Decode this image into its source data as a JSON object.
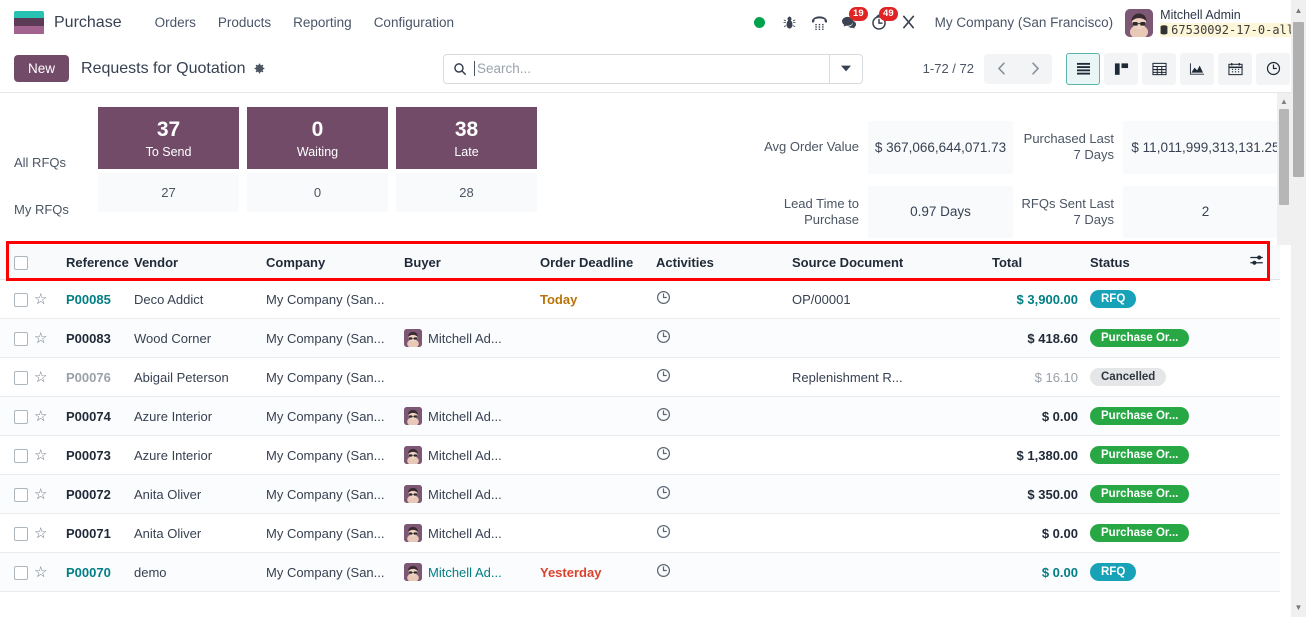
{
  "navbar": {
    "brand": "Purchase",
    "menu": [
      "Orders",
      "Products",
      "Reporting",
      "Configuration"
    ],
    "icons": [
      {
        "name": "status-dot-icon",
        "label": ""
      },
      {
        "name": "bug-icon",
        "label": ""
      },
      {
        "name": "voip-phone-icon",
        "label": ""
      },
      {
        "name": "messages-icon",
        "label": "",
        "count": "19"
      },
      {
        "name": "activities-clock-icon",
        "label": "",
        "count": "49"
      },
      {
        "name": "settings-tools-icon",
        "label": ""
      }
    ],
    "company": "My Company (San Francisco)",
    "user_name": "Mitchell Admin",
    "user_db": "67530092-17-0-all"
  },
  "control_panel": {
    "new_label": "New",
    "title": "Requests for Quotation",
    "gear_icon": "gear-icon",
    "search_placeholder": "Search...",
    "search_value": "",
    "pager": "1-72 / 72",
    "views": [
      {
        "name": "list-view",
        "icon": "list-icon",
        "active": true
      },
      {
        "name": "kanban-view",
        "icon": "kanban-icon",
        "active": false
      },
      {
        "name": "pivot-view",
        "icon": "pivot-icon",
        "active": false
      },
      {
        "name": "graph-view",
        "icon": "graph-icon",
        "active": false
      },
      {
        "name": "calendar-view",
        "icon": "calendar-icon",
        "active": false
      },
      {
        "name": "activity-view",
        "icon": "clock-icon",
        "active": false
      }
    ]
  },
  "dashboard": {
    "row_labels": [
      "All RFQs",
      "My RFQs"
    ],
    "columns": [
      {
        "label": "To Send",
        "all": "37",
        "my": "27"
      },
      {
        "label": "Waiting",
        "all": "0",
        "my": "0"
      },
      {
        "label": "Late",
        "all": "38",
        "my": "28"
      }
    ],
    "metrics": [
      {
        "label": "Avg Order Value",
        "value": "$ 367,066,644,071.73"
      },
      {
        "label": "Purchased Last 7 Days",
        "value": "$ 11,011,999,313,131.25"
      },
      {
        "label": "Lead Time to Purchase",
        "value": "0.97 Days"
      },
      {
        "label": "RFQs Sent Last 7 Days",
        "value": "2"
      }
    ]
  },
  "table": {
    "headers": [
      "Reference",
      "Vendor",
      "Company",
      "Buyer",
      "Order Deadline",
      "Activities",
      "Source Document",
      "Total",
      "Status"
    ],
    "config_icon": "column-options-icon",
    "rows": [
      {
        "reference": "P00085",
        "ref_link": true,
        "vendor": "Deco Addict",
        "vendor_link": true,
        "company": "My Company (San...",
        "company_link": true,
        "buyer": "",
        "has_avatar": false,
        "deadline": "Today",
        "deadline_style": "today",
        "activity_icon": "clock-icon",
        "source": "OP/00001",
        "source_link": true,
        "total": "$ 3,900.00",
        "total_style": "link",
        "status": "RFQ",
        "status_style": "rfq",
        "highlighted": true
      },
      {
        "reference": "P00083",
        "ref_link": false,
        "vendor": "Wood Corner",
        "vendor_link": false,
        "company": "My Company (San...",
        "company_link": false,
        "buyer": "Mitchell Ad...",
        "has_avatar": true,
        "deadline": "",
        "deadline_style": "",
        "activity_icon": "clock-icon",
        "source": "",
        "source_link": false,
        "total": "$ 418.60",
        "total_style": "bold",
        "status": "Purchase Or...",
        "status_style": "po",
        "highlighted": false
      },
      {
        "reference": "P00076",
        "ref_link": false,
        "vendor": "Abigail Peterson",
        "vendor_link": false,
        "company": "My Company (San...",
        "company_link": false,
        "buyer": "",
        "has_avatar": false,
        "deadline": "",
        "deadline_style": "",
        "activity_icon": "clock-icon",
        "source": "Replenishment R...",
        "source_link": false,
        "total": "$ 16.10",
        "total_style": "muted",
        "status": "Cancelled",
        "status_style": "cancel",
        "muted": true,
        "highlighted": false
      },
      {
        "reference": "P00074",
        "ref_link": false,
        "vendor": "Azure Interior",
        "vendor_link": false,
        "company": "My Company (San...",
        "company_link": false,
        "buyer": "Mitchell Ad...",
        "has_avatar": true,
        "deadline": "",
        "deadline_style": "",
        "activity_icon": "clock-icon",
        "source": "",
        "source_link": false,
        "total": "$ 0.00",
        "total_style": "bold",
        "status": "Purchase Or...",
        "status_style": "po",
        "highlighted": false
      },
      {
        "reference": "P00073",
        "ref_link": false,
        "vendor": "Azure Interior",
        "vendor_link": false,
        "company": "My Company (San...",
        "company_link": false,
        "buyer": "Mitchell Ad...",
        "has_avatar": true,
        "deadline": "",
        "deadline_style": "",
        "activity_icon": "clock-icon",
        "source": "",
        "source_link": false,
        "total": "$ 1,380.00",
        "total_style": "bold",
        "status": "Purchase Or...",
        "status_style": "po",
        "highlighted": false
      },
      {
        "reference": "P00072",
        "ref_link": false,
        "vendor": "Anita Oliver",
        "vendor_link": false,
        "company": "My Company (San...",
        "company_link": false,
        "buyer": "Mitchell Ad...",
        "has_avatar": true,
        "deadline": "",
        "deadline_style": "",
        "activity_icon": "clock-icon",
        "source": "",
        "source_link": false,
        "total": "$ 350.00",
        "total_style": "bold",
        "status": "Purchase Or...",
        "status_style": "po",
        "highlighted": false
      },
      {
        "reference": "P00071",
        "ref_link": false,
        "vendor": "Anita Oliver",
        "vendor_link": false,
        "company": "My Company (San...",
        "company_link": false,
        "buyer": "Mitchell Ad...",
        "has_avatar": true,
        "deadline": "",
        "deadline_style": "",
        "activity_icon": "clock-icon",
        "source": "",
        "source_link": false,
        "total": "$ 0.00",
        "total_style": "bold",
        "status": "Purchase Or...",
        "status_style": "po",
        "highlighted": false
      },
      {
        "reference": "P00070",
        "ref_link": true,
        "vendor": "demo",
        "vendor_link": true,
        "company": "My Company (San...",
        "company_link": true,
        "buyer": "Mitchell Ad...",
        "has_avatar": true,
        "deadline": "Yesterday",
        "deadline_style": "late",
        "activity_icon": "clock-icon",
        "source": "",
        "source_link": false,
        "total": "$ 0.00",
        "total_style": "link",
        "status": "RFQ",
        "status_style": "rfq",
        "highlighted": false
      }
    ]
  },
  "colors": {
    "brand_purple": "#714b67",
    "badge_rfq": "#17a2b8",
    "badge_po": "#28a745",
    "link": "#017e84",
    "highlight_red": "#fe0000",
    "status_green": "#00a24d",
    "notification_red": "#e02424"
  }
}
